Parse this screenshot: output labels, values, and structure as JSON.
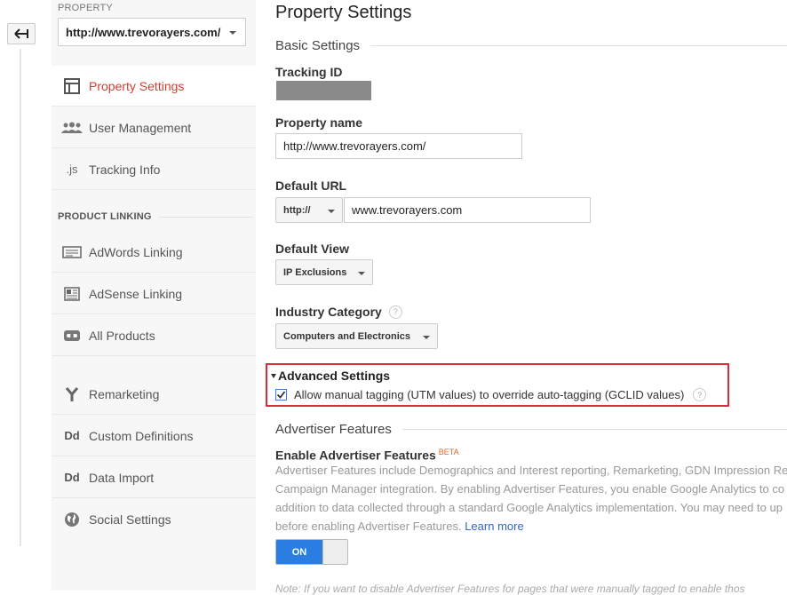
{
  "sidebar": {
    "property_label": "PROPERTY",
    "property_select": "http://www.trevorayers.com/",
    "items": [
      {
        "label": "Property Settings",
        "icon": "layout-icon"
      },
      {
        "label": "User Management",
        "icon": "users-icon"
      },
      {
        "label": "Tracking Info",
        "icon": "js-icon",
        "icon_text": ".js"
      }
    ],
    "product_linking_label": "PRODUCT LINKING",
    "linking_items": [
      {
        "label": "AdWords Linking",
        "icon": "adwords-icon"
      },
      {
        "label": "AdSense Linking",
        "icon": "adsense-icon"
      },
      {
        "label": "All Products",
        "icon": "link-icon"
      }
    ],
    "other_items": [
      {
        "label": "Remarketing",
        "icon": "remarketing-icon"
      },
      {
        "label": "Custom Definitions",
        "icon": "dd-icon",
        "icon_text": "Dd"
      },
      {
        "label": "Data Import",
        "icon": "dd-icon",
        "icon_text": "Dd"
      },
      {
        "label": "Social Settings",
        "icon": "globe-icon"
      }
    ]
  },
  "main": {
    "title": "Property Settings",
    "basic_settings": "Basic Settings",
    "tracking_id_label": "Tracking ID",
    "property_name_label": "Property name",
    "property_name_value": "http://www.trevorayers.com/",
    "default_url_label": "Default URL",
    "url_protocol": "http://",
    "url_value": "www.trevorayers.com",
    "default_view_label": "Default View",
    "default_view_value": "IP Exclusions",
    "industry_label": "Industry Category",
    "industry_value": "Computers and Electronics",
    "advanced_title": "Advanced Settings",
    "advanced_checkbox_label": "Allow manual tagging (UTM values) to override auto-tagging (GCLID values)",
    "advertiser_features": "Advertiser Features",
    "enable_adv_label": "Enable Advertiser Features",
    "beta": "BETA",
    "desc_line1": "Advertiser Features include Demographics and Interest reporting, Remarketing, GDN Impression Re",
    "desc_line2": "Campaign Manager integration. By enabling Advertiser Features, you enable Google Analytics to co",
    "desc_line3": "addition to data collected through a standard Google Analytics implementation. You may need to up",
    "desc_line4": "before enabling Advertiser Features.",
    "learn_more": "Learn more",
    "toggle_label": "ON",
    "note": "Note: If you want to disable Advertiser Features for pages that were manually tagged to enable thos"
  },
  "colors": {
    "accent": "#d23f31",
    "highlight_box": "#d62d3a",
    "toggle_on": "#2a7de1",
    "link": "#3366cc"
  }
}
